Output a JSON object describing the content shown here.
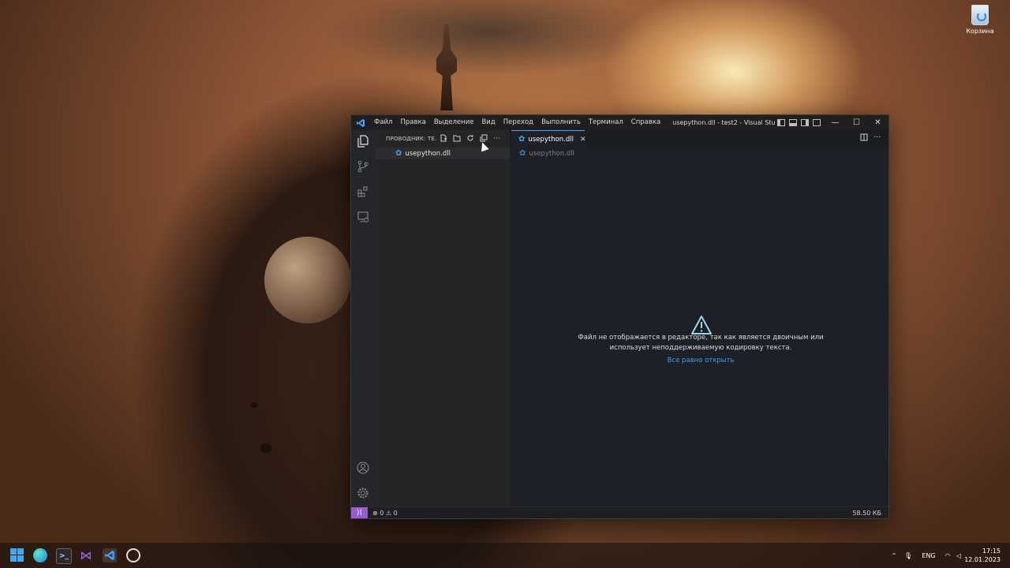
{
  "desktop": {
    "recycle_bin_label": "Корзина"
  },
  "window": {
    "title": "usepython.dll - test2 - Visual Studio Co...",
    "menu": [
      "Файл",
      "Правка",
      "Выделение",
      "Вид",
      "Переход",
      "Выполнить",
      "Терминал",
      "Справка"
    ],
    "controls": {
      "minimize": "—",
      "maximize": "☐",
      "close": "✕"
    }
  },
  "sidebar": {
    "title": "ПРОВОДНИК: TE...",
    "files": [
      "usepython.dll"
    ]
  },
  "editor": {
    "tab_label": "usepython.dll",
    "breadcrumb": "usepython.dll",
    "message_line1": "Файл не отображается в редакторе, так как является двоичным или",
    "message_line2": "использует неподдерживаемую кодировку текста.",
    "open_anyway": "Все равно открыть"
  },
  "statusbar": {
    "problems": "⊗ 0 ⚠ 0",
    "file_size": "58.50 КБ"
  },
  "taskbar": {
    "language": "ENG",
    "time": "17:15",
    "date": "12.01.2023"
  },
  "colors": {
    "accent": "#3fa8ff",
    "link": "#3f9cf0",
    "remote": "#9b59d6",
    "warning_icon": "#9ad7e8"
  },
  "icons": {
    "activitybar": [
      "explorer-icon",
      "source-control-icon",
      "extensions-icon",
      "remote-explorer-icon",
      "account-icon",
      "settings-gear-icon"
    ],
    "sidebar_tools": [
      "new-file-icon",
      "new-folder-icon",
      "refresh-icon",
      "collapse-all-icon",
      "more-icon"
    ]
  }
}
